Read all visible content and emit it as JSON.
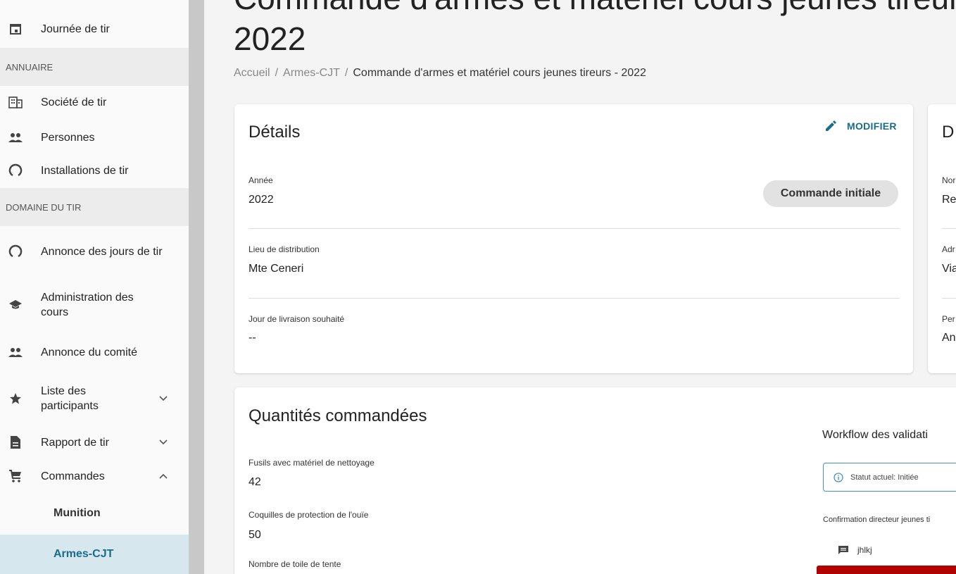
{
  "sidebar": {
    "items": [
      {
        "label": "Journée de tir",
        "icon": "calendar-icon"
      },
      {
        "section": "ANNUAIRE"
      },
      {
        "label": "Société de tir",
        "icon": "building-icon"
      },
      {
        "label": "Personnes",
        "icon": "people-icon"
      },
      {
        "label": "Installations de tir",
        "icon": "loader-icon"
      },
      {
        "section": "DOMAINE DU TIR"
      },
      {
        "label": "Annonce des jours de tir",
        "icon": "loader-icon"
      },
      {
        "label": "Administration des cours",
        "icon": "school-icon"
      },
      {
        "label": "Annonce du comité",
        "icon": "people-icon"
      },
      {
        "label": "Liste des participants",
        "icon": "star-icon"
      },
      {
        "label": "Rapport de tir",
        "icon": "document-icon"
      },
      {
        "label": "Commandes",
        "icon": "cart-icon"
      },
      {
        "label": "Munition"
      },
      {
        "label": "Armes-CJT"
      }
    ],
    "section_annuaire": "ANNUAIRE",
    "section_domaine": "DOMAINE DU TIR",
    "journee": "Journée de tir",
    "societe": "Société de tir",
    "personnes": "Personnes",
    "installations": "Installations de tir",
    "annonce_jours": "Annonce des jours de tir",
    "admin_cours": "Administration des cours",
    "annonce_comite": "Annonce du comité",
    "liste_participants": "Liste des participants",
    "rapport_tir": "Rapport de tir",
    "commandes": "Commandes",
    "munition": "Munition",
    "armes_cjt": "Armes-CJT"
  },
  "header": {
    "title_top": "Commande d'armes et matériel cours jeunes tireurs -",
    "title_year": "2022",
    "breadcrumb": {
      "home": "Accueil",
      "sep": "/",
      "parent": "Armes-CJT",
      "current": "Commande d'armes et matériel cours jeunes tireurs - 2022"
    }
  },
  "details": {
    "title": "Détails",
    "edit_label": "MODIFIER",
    "annee_label": "Année",
    "annee_value": "2022",
    "status_chip": "Commande initiale",
    "lieu_label": "Lieu de distribution",
    "lieu_value": "Mte Ceneri",
    "jour_label": "Jour de livraison souhaité",
    "jour_value": "--"
  },
  "right_card": {
    "title": "D",
    "fields": [
      {
        "label": "Nor",
        "value": "Re"
      },
      {
        "label": "Adr",
        "value": "Via"
      },
      {
        "label": "Per",
        "value": "An"
      }
    ]
  },
  "quantities": {
    "title": "Quantités commandées",
    "items": [
      {
        "label": "Fusils avec matériel de nettoyage",
        "value": "42"
      },
      {
        "label": "Coquilles de protection de l'ouïe",
        "value": "50"
      },
      {
        "label": "Nombre de toile de tente",
        "value": ""
      }
    ]
  },
  "workflow": {
    "title": "Workflow des validati",
    "status": "Statut actuel: Initiée",
    "step_label": "Confirmation directeur jeunes ti",
    "comment": "jhlkj"
  },
  "colors": {
    "accent": "#1a6c8c",
    "active_bg": "#d6e7ee",
    "danger": "#b30000"
  }
}
